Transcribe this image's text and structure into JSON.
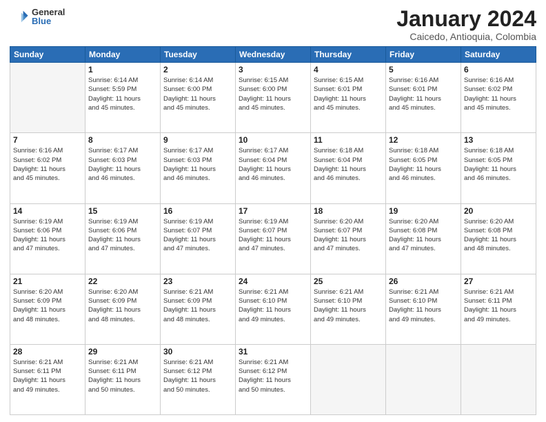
{
  "logo": {
    "general": "General",
    "blue": "Blue"
  },
  "title": {
    "month_year": "January 2024",
    "location": "Caicedo, Antioquia, Colombia"
  },
  "weekdays": [
    "Sunday",
    "Monday",
    "Tuesday",
    "Wednesday",
    "Thursday",
    "Friday",
    "Saturday"
  ],
  "weeks": [
    [
      {
        "day": "",
        "info": ""
      },
      {
        "day": "1",
        "info": "Sunrise: 6:14 AM\nSunset: 5:59 PM\nDaylight: 11 hours\nand 45 minutes."
      },
      {
        "day": "2",
        "info": "Sunrise: 6:14 AM\nSunset: 6:00 PM\nDaylight: 11 hours\nand 45 minutes."
      },
      {
        "day": "3",
        "info": "Sunrise: 6:15 AM\nSunset: 6:00 PM\nDaylight: 11 hours\nand 45 minutes."
      },
      {
        "day": "4",
        "info": "Sunrise: 6:15 AM\nSunset: 6:01 PM\nDaylight: 11 hours\nand 45 minutes."
      },
      {
        "day": "5",
        "info": "Sunrise: 6:16 AM\nSunset: 6:01 PM\nDaylight: 11 hours\nand 45 minutes."
      },
      {
        "day": "6",
        "info": "Sunrise: 6:16 AM\nSunset: 6:02 PM\nDaylight: 11 hours\nand 45 minutes."
      }
    ],
    [
      {
        "day": "7",
        "info": "Sunrise: 6:16 AM\nSunset: 6:02 PM\nDaylight: 11 hours\nand 45 minutes."
      },
      {
        "day": "8",
        "info": "Sunrise: 6:17 AM\nSunset: 6:03 PM\nDaylight: 11 hours\nand 46 minutes."
      },
      {
        "day": "9",
        "info": "Sunrise: 6:17 AM\nSunset: 6:03 PM\nDaylight: 11 hours\nand 46 minutes."
      },
      {
        "day": "10",
        "info": "Sunrise: 6:17 AM\nSunset: 6:04 PM\nDaylight: 11 hours\nand 46 minutes."
      },
      {
        "day": "11",
        "info": "Sunrise: 6:18 AM\nSunset: 6:04 PM\nDaylight: 11 hours\nand 46 minutes."
      },
      {
        "day": "12",
        "info": "Sunrise: 6:18 AM\nSunset: 6:05 PM\nDaylight: 11 hours\nand 46 minutes."
      },
      {
        "day": "13",
        "info": "Sunrise: 6:18 AM\nSunset: 6:05 PM\nDaylight: 11 hours\nand 46 minutes."
      }
    ],
    [
      {
        "day": "14",
        "info": "Sunrise: 6:19 AM\nSunset: 6:06 PM\nDaylight: 11 hours\nand 47 minutes."
      },
      {
        "day": "15",
        "info": "Sunrise: 6:19 AM\nSunset: 6:06 PM\nDaylight: 11 hours\nand 47 minutes."
      },
      {
        "day": "16",
        "info": "Sunrise: 6:19 AM\nSunset: 6:07 PM\nDaylight: 11 hours\nand 47 minutes."
      },
      {
        "day": "17",
        "info": "Sunrise: 6:19 AM\nSunset: 6:07 PM\nDaylight: 11 hours\nand 47 minutes."
      },
      {
        "day": "18",
        "info": "Sunrise: 6:20 AM\nSunset: 6:07 PM\nDaylight: 11 hours\nand 47 minutes."
      },
      {
        "day": "19",
        "info": "Sunrise: 6:20 AM\nSunset: 6:08 PM\nDaylight: 11 hours\nand 47 minutes."
      },
      {
        "day": "20",
        "info": "Sunrise: 6:20 AM\nSunset: 6:08 PM\nDaylight: 11 hours\nand 48 minutes."
      }
    ],
    [
      {
        "day": "21",
        "info": "Sunrise: 6:20 AM\nSunset: 6:09 PM\nDaylight: 11 hours\nand 48 minutes."
      },
      {
        "day": "22",
        "info": "Sunrise: 6:20 AM\nSunset: 6:09 PM\nDaylight: 11 hours\nand 48 minutes."
      },
      {
        "day": "23",
        "info": "Sunrise: 6:21 AM\nSunset: 6:09 PM\nDaylight: 11 hours\nand 48 minutes."
      },
      {
        "day": "24",
        "info": "Sunrise: 6:21 AM\nSunset: 6:10 PM\nDaylight: 11 hours\nand 49 minutes."
      },
      {
        "day": "25",
        "info": "Sunrise: 6:21 AM\nSunset: 6:10 PM\nDaylight: 11 hours\nand 49 minutes."
      },
      {
        "day": "26",
        "info": "Sunrise: 6:21 AM\nSunset: 6:10 PM\nDaylight: 11 hours\nand 49 minutes."
      },
      {
        "day": "27",
        "info": "Sunrise: 6:21 AM\nSunset: 6:11 PM\nDaylight: 11 hours\nand 49 minutes."
      }
    ],
    [
      {
        "day": "28",
        "info": "Sunrise: 6:21 AM\nSunset: 6:11 PM\nDaylight: 11 hours\nand 49 minutes."
      },
      {
        "day": "29",
        "info": "Sunrise: 6:21 AM\nSunset: 6:11 PM\nDaylight: 11 hours\nand 50 minutes."
      },
      {
        "day": "30",
        "info": "Sunrise: 6:21 AM\nSunset: 6:12 PM\nDaylight: 11 hours\nand 50 minutes."
      },
      {
        "day": "31",
        "info": "Sunrise: 6:21 AM\nSunset: 6:12 PM\nDaylight: 11 hours\nand 50 minutes."
      },
      {
        "day": "",
        "info": ""
      },
      {
        "day": "",
        "info": ""
      },
      {
        "day": "",
        "info": ""
      }
    ]
  ]
}
